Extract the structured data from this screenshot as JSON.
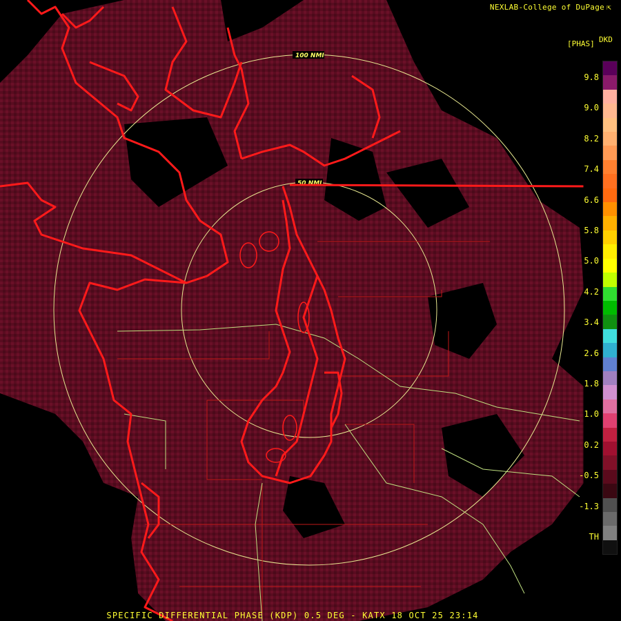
{
  "credit": "NEXLAB-College of DuPage",
  "legend": {
    "code": "DKD",
    "unit": "[PHAS]",
    "ticks": [
      "9.8",
      "9.0",
      "8.2",
      "7.4",
      "6.6",
      "5.8",
      "5.0",
      "4.2",
      "3.4",
      "2.6",
      "1.8",
      "1.0",
      "0.2",
      "-0.5",
      "-1.3",
      "TH"
    ],
    "colors": [
      "#5a005a",
      "#8a1a6a",
      "#ffb0a0",
      "#ffb890",
      "#ffc080",
      "#ffb070",
      "#ff9a55",
      "#ff8030",
      "#ff7020",
      "#ff6a10",
      "#ff9000",
      "#ffb000",
      "#ffd000",
      "#ffee00",
      "#ffff00",
      "#c0ff00",
      "#30dd30",
      "#00bb00",
      "#109010",
      "#40dddd",
      "#30b0d0",
      "#6080d0",
      "#a080c0",
      "#d090d0",
      "#e070a0",
      "#e04070",
      "#c02040",
      "#a01030",
      "#801028",
      "#5a0a1c",
      "#3a0812",
      "#505050",
      "#6a6a6a",
      "#808080",
      "#101010"
    ]
  },
  "rings": [
    "100 NMI",
    "50 NMI"
  ],
  "caption": "SPECIFIC DIFFERENTIAL PHASE (KDP) 0.5 DEG - KATX 18 OCT 25 23:14"
}
